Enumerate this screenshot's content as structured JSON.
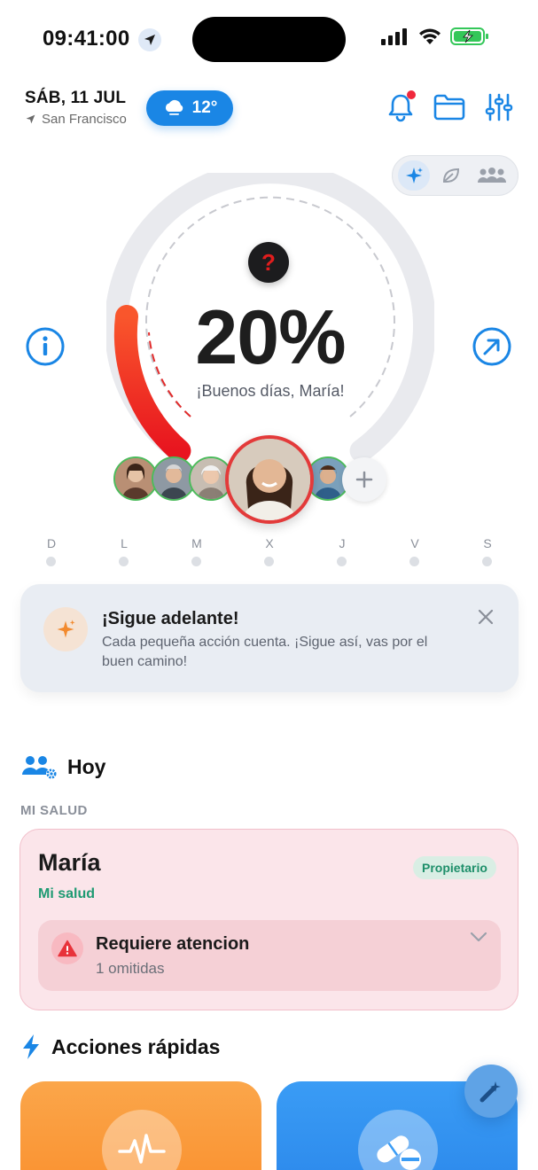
{
  "status_bar": {
    "time": "09:41:00"
  },
  "header": {
    "date": "SÁB, 11 JUL",
    "city": "San Francisco",
    "weather_temp": "12°"
  },
  "ring": {
    "percent_label": "20%",
    "progress": 0.2,
    "greeting": "¡Buenos días, María!",
    "help_symbol": "?"
  },
  "week_days": [
    "D",
    "L",
    "M",
    "X",
    "J",
    "V",
    "S"
  ],
  "motivation": {
    "title": "¡Sigue adelante!",
    "text": "Cada pequeña acción cuenta. ¡Sigue así, vas por el buen camino!"
  },
  "today": {
    "title": "Hoy",
    "section_label": "MI SALUD",
    "card": {
      "name": "María",
      "subtitle": "Mi salud",
      "badge": "Propietario",
      "attention_title": "Requiere atencion",
      "attention_sub": "1 omitidas"
    }
  },
  "quick_actions": {
    "title": "Acciones rápidas",
    "cards": [
      {
        "icon": "heart-rate-icon",
        "color": "#f98e2c"
      },
      {
        "icon": "pill-icon",
        "color": "#2a86ea"
      }
    ]
  },
  "colors": {
    "accent": "#1a86e5",
    "ring_progress": "#f23a2a",
    "owner_green": "#1e9a72"
  }
}
